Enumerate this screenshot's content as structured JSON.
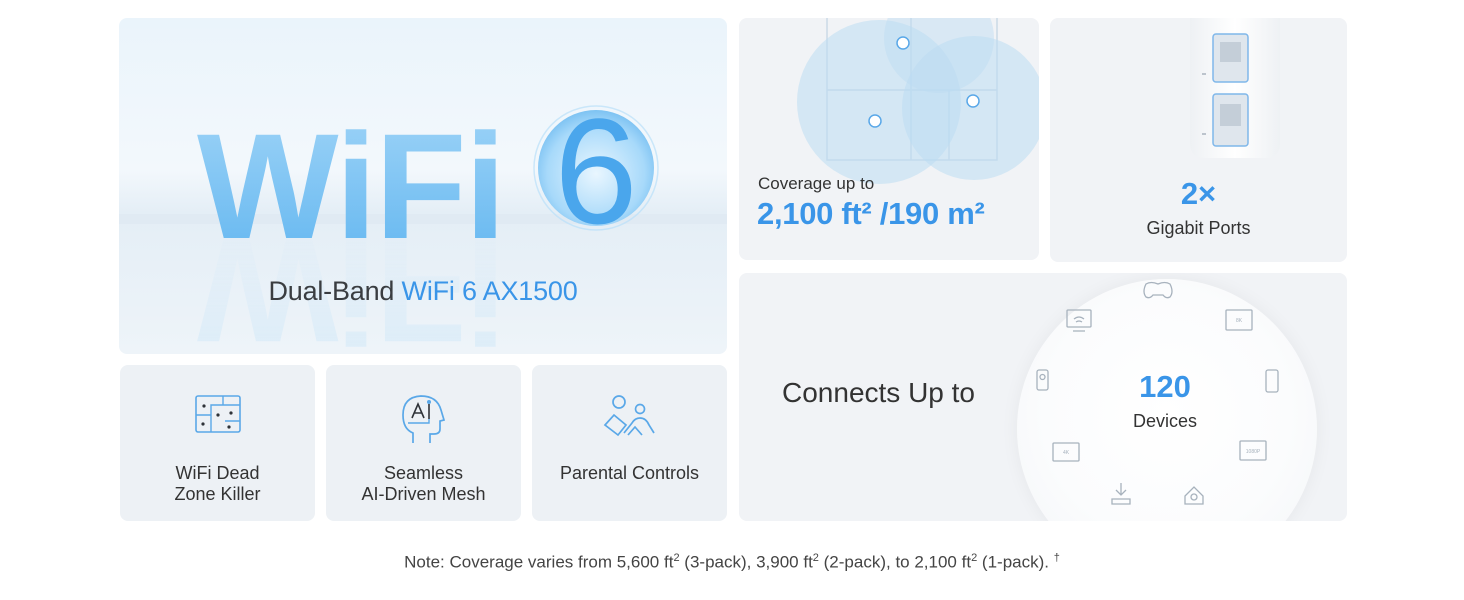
{
  "hero": {
    "logo_text": "WiFi",
    "logo_number": "6",
    "subtitle_plain": "Dual-Band ",
    "subtitle_accent": "WiFi 6 AX1500"
  },
  "coverage": {
    "label": "Coverage up to",
    "value": "2,100 ft² /190 m²"
  },
  "ports": {
    "count": "2×",
    "label": "Gigabit Ports"
  },
  "connects": {
    "title": "Connects Up to",
    "count": "120",
    "label": "Devices",
    "device_badges": [
      "8K",
      "4K",
      "1080P"
    ]
  },
  "features": [
    {
      "label_line1": "WiFi Dead",
      "label_line2": "Zone Killer",
      "icon": "dead-zone-icon"
    },
    {
      "label_line1": "Seamless",
      "label_line2": "AI-Driven Mesh",
      "icon": "ai-mesh-icon"
    },
    {
      "label_line1": "Parental Controls",
      "label_line2": "",
      "icon": "parental-controls-icon"
    }
  ],
  "note": {
    "prefix": "Note: Coverage varies from 5,600 ft",
    "sup1": "2",
    "mid1": " (3-pack), 3,900 ft",
    "sup2": "2",
    "mid2": " (2-pack), to 2,100 ft",
    "sup3": "2",
    "suffix": " (1-pack).",
    "dagger": "†"
  },
  "colors": {
    "accent": "#3a95e8",
    "tile_bg": "#f1f3f6",
    "text": "#333333"
  }
}
